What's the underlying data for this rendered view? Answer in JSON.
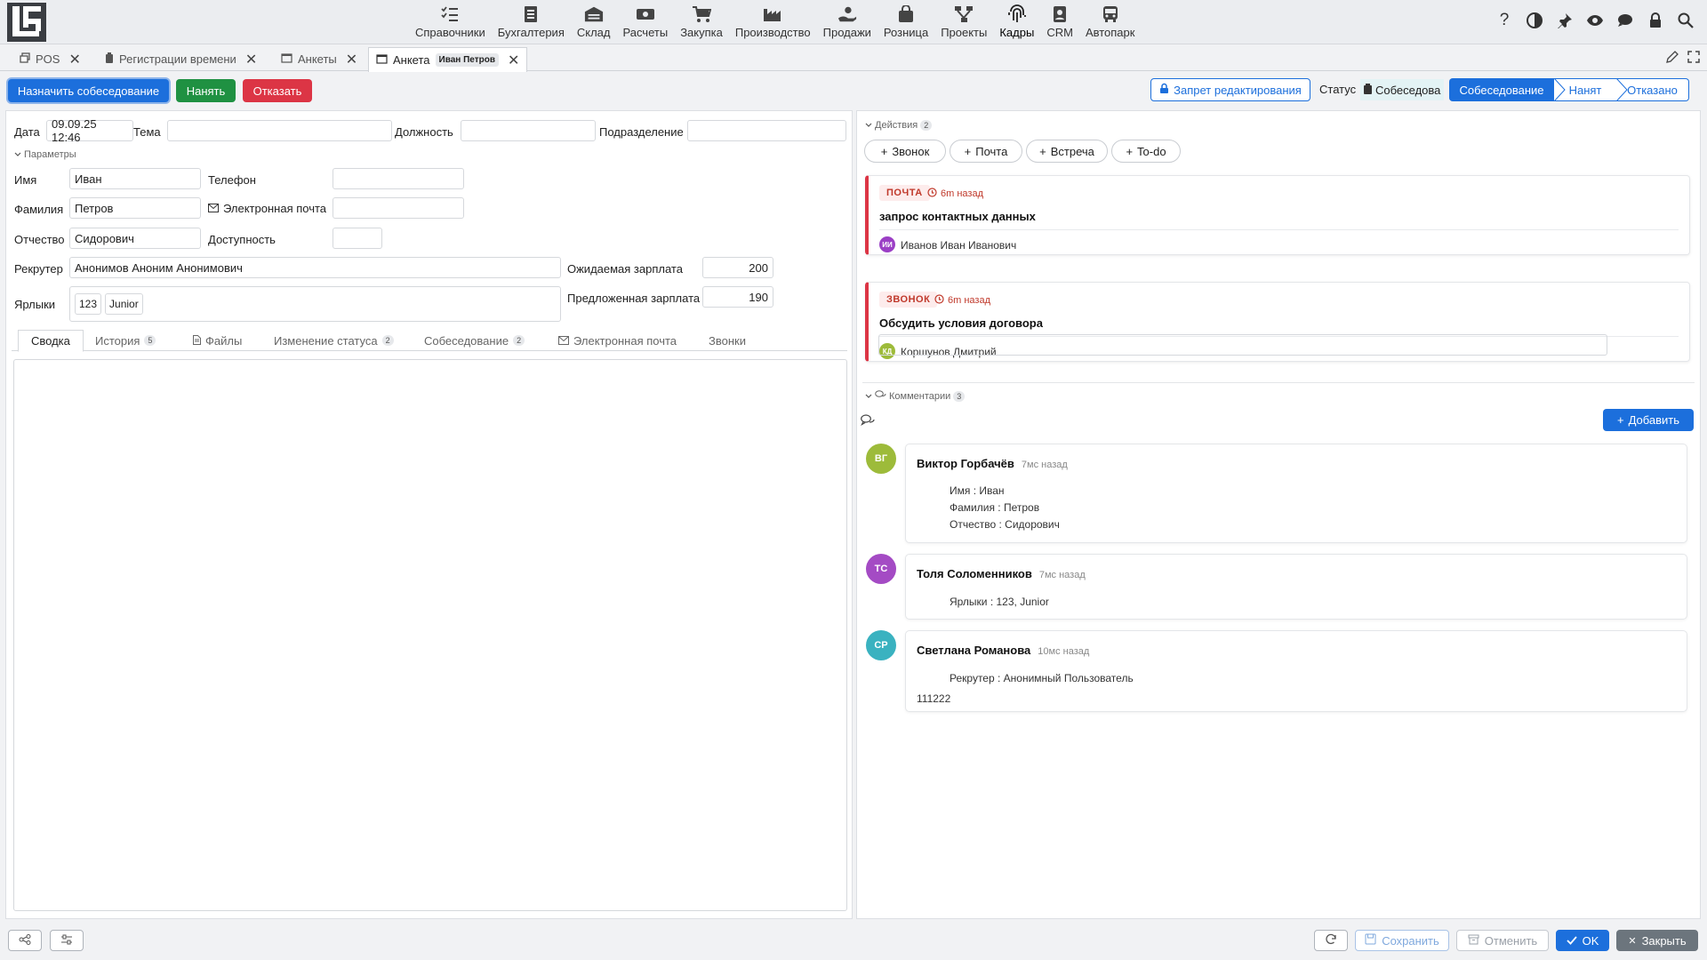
{
  "nav": {
    "modules": [
      {
        "label": "Справочники",
        "icon": "checklist-icon"
      },
      {
        "label": "Бухгалтерия",
        "icon": "ledger-icon"
      },
      {
        "label": "Склад",
        "icon": "warehouse-icon"
      },
      {
        "label": "Расчеты",
        "icon": "money-icon"
      },
      {
        "label": "Закупка",
        "icon": "cart-icon"
      },
      {
        "label": "Производство",
        "icon": "factory-icon"
      },
      {
        "label": "Продажи",
        "icon": "hand-coin-icon"
      },
      {
        "label": "Розница",
        "icon": "shopping-bag-icon"
      },
      {
        "label": "Проекты",
        "icon": "project-tree-icon"
      },
      {
        "label": "Кадры",
        "icon": "fingerprint-icon"
      },
      {
        "label": "CRM",
        "icon": "contact-card-icon"
      },
      {
        "label": "Автопарк",
        "icon": "bus-icon"
      }
    ],
    "active_module": "Кадры"
  },
  "tabs": [
    {
      "label": "POS"
    },
    {
      "label": "Регистрации времени"
    },
    {
      "label": "Анкеты"
    },
    {
      "label": "Анкета",
      "chip": "Иван Петров"
    }
  ],
  "toolbar": {
    "schedule_label": "Назначить собеседование",
    "hire_label": "Нанять",
    "reject_label": "Отказать",
    "lock_label": "Запрет редактирования",
    "status_label": "Статус",
    "status_value": "Собеседова",
    "steps": [
      "Собеседование",
      "Нанят",
      "Отказано"
    ]
  },
  "form": {
    "date_label": "Дата",
    "date_value": "09.09.25 12:46",
    "topic_label": "Тема",
    "topic_value": "",
    "position_label": "Должность",
    "position_value": "",
    "department_label": "Подразделение",
    "department_value": "",
    "params_label": "Параметры",
    "first_name_label": "Имя",
    "first_name_value": "Иван",
    "last_name_label": "Фамилия",
    "last_name_value": "Петров",
    "patronymic_label": "Отчество",
    "patronymic_value": "Сидорович",
    "phone_label": "Телефон",
    "phone_value": "",
    "email_label": "Электронная почта",
    "email_value": "",
    "availability_label": "Доступность",
    "availability_value": "",
    "recruiter_label": "Рекрутер",
    "recruiter_value": "Анонимов Аноним Анонимович",
    "tags_label": "Ярлыки",
    "tags": [
      "123",
      "Junior"
    ],
    "expected_salary_label": "Ожидаемая зарплата",
    "expected_salary_value": "200",
    "offered_salary_label": "Предложенная зарплата",
    "offered_salary_value": "190"
  },
  "inner_tabs": [
    {
      "label": "Сводка",
      "badge": ""
    },
    {
      "label": "История",
      "badge": "5"
    },
    {
      "label": "Файлы",
      "badge": ""
    },
    {
      "label": "Изменение статуса",
      "badge": "2"
    },
    {
      "label": "Собеседование",
      "badge": "2"
    },
    {
      "label": "Электронная почта",
      "badge": ""
    },
    {
      "label": "Звонки",
      "badge": ""
    }
  ],
  "actions": {
    "label": "Действия",
    "count": "2",
    "buttons": [
      "Звонок",
      "Почта",
      "Встреча",
      "To-do"
    ],
    "items": [
      {
        "type": "ПОЧТА",
        "time": "6m назад",
        "title": "запрос контактных данных",
        "initials": "ИИ",
        "user": "Иванов Иван Иванович",
        "avatar_color": "#9b3fc5"
      },
      {
        "type": "ЗВОНОК",
        "time": "6m назад",
        "title": "Обсудить условия договора",
        "initials": "КД",
        "user": "Коршунов Дмитрий",
        "avatar_color": "#9dbb3a"
      }
    ]
  },
  "comments": {
    "label": "Комментарии",
    "count": "3",
    "add_label": "Добавить",
    "items": [
      {
        "initials": "ВГ",
        "author": "Виктор Горбачёв",
        "time": "7мс назад",
        "lines": [
          "Имя : Иван",
          "Фамилия : Петров",
          "Отчество : Сидорович"
        ],
        "avatar_color": "#9dbb3a"
      },
      {
        "initials": "ТС",
        "author": "Толя Соломенников",
        "time": "7мс назад",
        "lines": [
          "Ярлыки : 123, Junior"
        ],
        "avatar_color": "#a44bc4"
      },
      {
        "initials": "СР",
        "author": "Светлана Романова",
        "time": "10мс назад",
        "lines": [
          "Рекрутер : Анонимный Пользователь",
          "111222"
        ],
        "avatar_color": "#3ab2c0"
      }
    ]
  },
  "footer": {
    "save_label": "Сохранить",
    "cancel_label": "Отменить",
    "ok_label": "OK",
    "close_label": "Закрыть"
  },
  "colors": {
    "primary": "#1c6fdc",
    "success": "#1f9142",
    "danger": "#dc3545"
  }
}
